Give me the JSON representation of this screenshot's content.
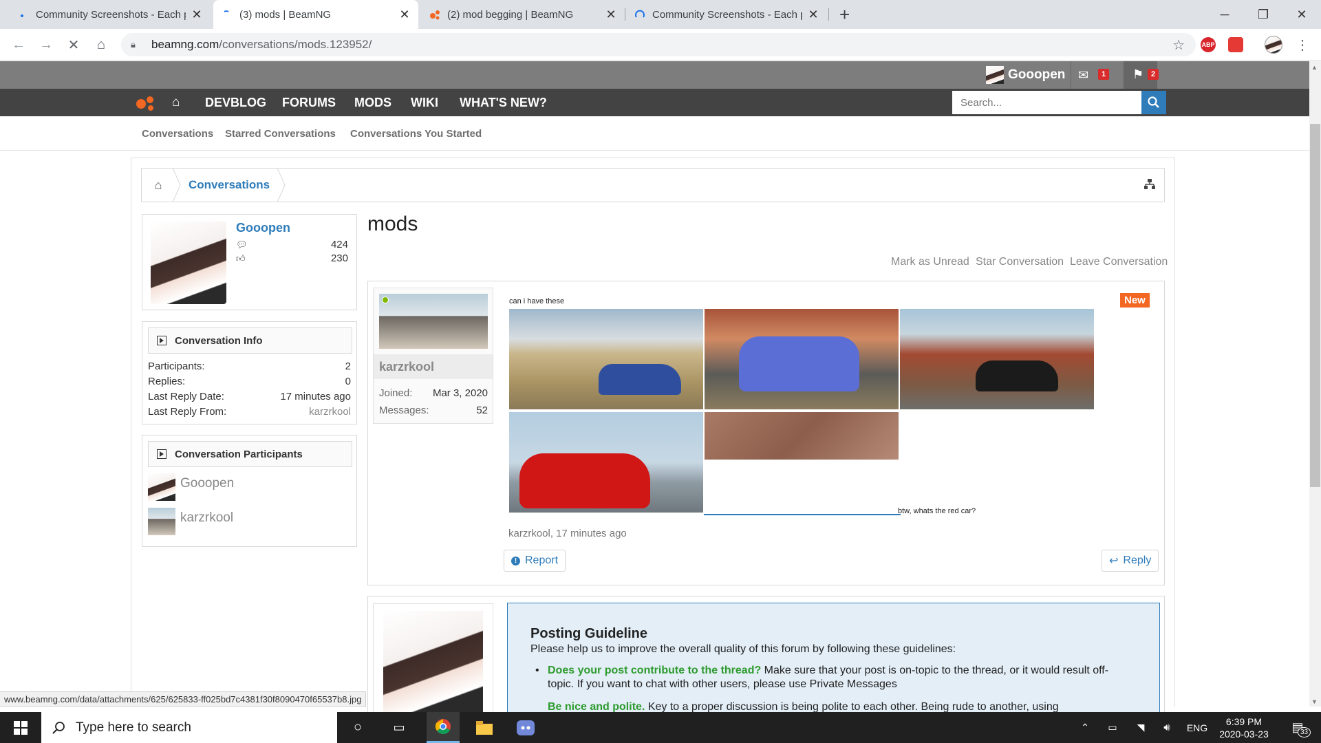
{
  "browser": {
    "tabs": [
      {
        "title": "Community Screenshots - Each p"
      },
      {
        "title": "(3) mods | BeamNG"
      },
      {
        "title": "(2) mod begging | BeamNG"
      },
      {
        "title": "Community Screenshots - Each p"
      }
    ],
    "url_host": "beamng.com",
    "url_path": "/conversations/mods.123952/",
    "extension_abp": "ABP",
    "status_url": "www.beamng.com/data/attachments/625/625833-ff025bd7c4381f30f8090470f65537b8.jpg"
  },
  "userbar": {
    "username": "Gooopen",
    "inbox_count": "1",
    "alerts_count": "2"
  },
  "nav": {
    "items": [
      "DEVBLOG",
      "FORUMS",
      "MODS",
      "WIKI",
      "WHAT'S NEW?"
    ],
    "search_placeholder": "Search..."
  },
  "subnav": {
    "items": [
      "Conversations",
      "Starred Conversations",
      "Conversations You Started"
    ]
  },
  "breadcrumb": {
    "current": "Conversations"
  },
  "visitor": {
    "name": "Gooopen",
    "messages": "424",
    "likes": "230"
  },
  "conversation_info": {
    "heading": "Conversation Info",
    "rows": [
      {
        "label": "Participants:",
        "value": "2"
      },
      {
        "label": "Replies:",
        "value": "0"
      },
      {
        "label": "Last Reply Date:",
        "value": "17 minutes ago"
      },
      {
        "label": "Last Reply From:",
        "value": "karzrkool"
      }
    ]
  },
  "participants": {
    "heading": "Conversation Participants",
    "users": [
      "Gooopen",
      "karzrkool"
    ]
  },
  "page": {
    "title": "mods",
    "actions": [
      "Mark as Unread",
      "Star Conversation",
      "Leave Conversation"
    ]
  },
  "message": {
    "author": "karzrkool",
    "joined_label": "Joined:",
    "joined_value": "Mar 3, 2020",
    "messages_label": "Messages:",
    "messages_value": "52",
    "new_badge": "New",
    "text_top": "can i have these",
    "text_bottom": "btw, whats the red car?",
    "meta": "karzrkool, 17 minutes ago",
    "report_label": "Report",
    "reply_label": "Reply"
  },
  "guideline": {
    "title": "Posting Guideline",
    "intro": "Please help us to improve the overall quality of this forum by following these guidelines:",
    "items": [
      {
        "bold": "Does your post contribute to the thread?",
        "text": " Make sure that your post is on-topic to the thread, or it would result off-topic. If you want to chat with other users, please use Private Messages"
      },
      {
        "bold": "Be nice and polite.",
        "text": " Key to a proper discussion is being polite to each other. Being rude to another, using"
      }
    ]
  },
  "taskbar": {
    "search_placeholder": "Type here to search",
    "lang": "ENG",
    "time": "6:39 PM",
    "date": "2020-03-23",
    "notif_count": "33"
  },
  "colors": {
    "accent": "#2e7cba",
    "new_badge": "#f26722",
    "brand": "#f26722",
    "guideline_green": "#2e9b2e"
  }
}
